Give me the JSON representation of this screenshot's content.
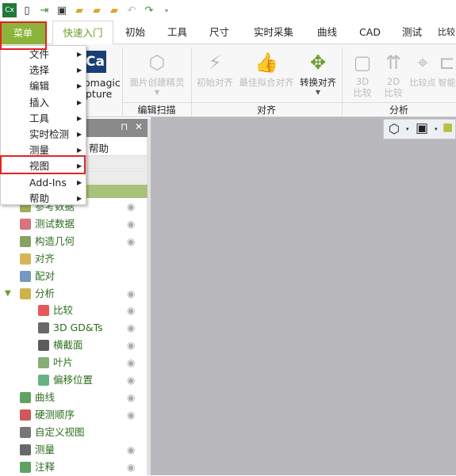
{
  "app_icon": "Cx",
  "quick_access": [
    "new-icon",
    "import-icon",
    "save-icon",
    "open-folder-icon",
    "export-folder-icon",
    "settings-folder-icon",
    "undo-icon",
    "redo-icon",
    "customize-dropdown-icon"
  ],
  "menu_button": "菜单",
  "tabs": [
    "快速入门",
    "初始",
    "工具",
    "尺寸",
    "实时采集",
    "曲线",
    "CAD",
    "测试",
    "比较"
  ],
  "active_tab": "快速入门",
  "ribbon": {
    "capture_partial": [
      "omagic",
      "pture"
    ],
    "capture_logo": "Ca",
    "edit_scan": {
      "label": "编辑扫描",
      "buttons": [
        "面片创建精灵"
      ]
    },
    "align": {
      "label": "对齐",
      "buttons": [
        "初始对齐",
        "最佳拟合对齐",
        "转换对齐"
      ]
    },
    "analysis": {
      "label": "分析",
      "buttons": [
        "3D\n比较",
        "2D\n比较",
        "比较点",
        "智能"
      ]
    }
  },
  "dropdown": {
    "items": [
      "文件",
      "选择",
      "编辑",
      "插入",
      "工具",
      "实时检测",
      "测量",
      "视图",
      "Add-Ins",
      "帮助"
    ],
    "highlighted": "视图"
  },
  "panel": {
    "menu_partial": "帮助",
    "pin": "⊓",
    "close": "✕",
    "tree": [
      {
        "label": "参考数据",
        "eye": true,
        "level": 0
      },
      {
        "label": "测试数据",
        "eye": true,
        "level": 0
      },
      {
        "label": "构造几何",
        "eye": true,
        "level": 0
      },
      {
        "label": "对齐",
        "eye": false,
        "level": 0
      },
      {
        "label": "配对",
        "eye": false,
        "level": 0
      },
      {
        "label": "分析",
        "eye": true,
        "level": 0,
        "expanded": true
      },
      {
        "label": "比较",
        "eye": true,
        "level": 1
      },
      {
        "label": "3D GD&Ts",
        "eye": true,
        "level": 1
      },
      {
        "label": "横截面",
        "eye": true,
        "level": 1
      },
      {
        "label": "叶片",
        "eye": true,
        "level": 1
      },
      {
        "label": "偏移位置",
        "eye": true,
        "level": 1
      },
      {
        "label": "曲线",
        "eye": true,
        "level": 0
      },
      {
        "label": "硬测顺序",
        "eye": true,
        "level": 0
      },
      {
        "label": "自定义视图",
        "eye": false,
        "level": 0
      },
      {
        "label": "测量",
        "eye": true,
        "level": 0
      },
      {
        "label": "注释",
        "eye": true,
        "level": 0
      }
    ]
  },
  "colors": {
    "accent": "#8cb43a",
    "highlight": "#e5231f",
    "viewport": "#b9b8bc",
    "tree_text": "#2c6e1e"
  }
}
